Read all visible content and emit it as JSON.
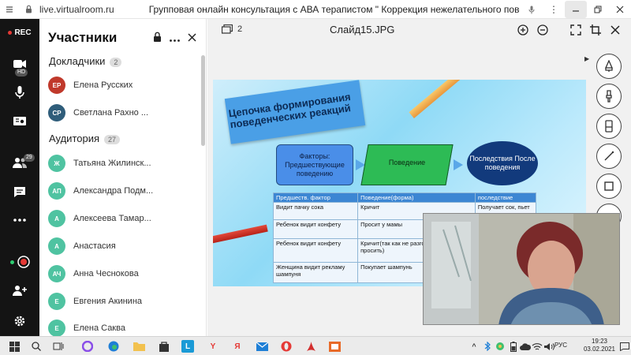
{
  "browser": {
    "url": "live.virtualroom.ru",
    "tab_title": "Групповая онлайн консультация с АВА терапистом \" Коррекция нежелательного поведения\"."
  },
  "rail": {
    "rec_label": "REC",
    "camera_badge": "HD",
    "participants_badge": "29"
  },
  "participants": {
    "title": "Участники",
    "speakers_label": "Докладчики",
    "speakers_count": "2",
    "audience_label": "Аудитория",
    "audience_count": "27",
    "speakers": [
      {
        "initials": "ЕР",
        "name": "Елена Русских",
        "color": "#c0392b"
      },
      {
        "initials": "СР",
        "name": "Светлана Рахно ...",
        "color": "#2f5d7a"
      }
    ],
    "audience": [
      {
        "initials": "Ж",
        "name": "Татьяна Жилинск...",
        "color": "#4fc3a1"
      },
      {
        "initials": "АП",
        "name": "Александра Подм...",
        "color": "#4fc3a1"
      },
      {
        "initials": "А",
        "name": "Алексеева Тамар...",
        "color": "#4fc3a1"
      },
      {
        "initials": "А",
        "name": "Анастасия",
        "color": "#4fc3a1"
      },
      {
        "initials": "АЧ",
        "name": "Анна Чеснокова",
        "color": "#4fc3a1"
      },
      {
        "initials": "Е",
        "name": "Евгения Акинина",
        "color": "#4fc3a1"
      },
      {
        "initials": "Е",
        "name": "Елена Саква",
        "color": "#4fc3a1"
      }
    ]
  },
  "viewer": {
    "page_count": "2",
    "file_name": "Слайд15.JPG"
  },
  "slide": {
    "title": "Цепочка формирования поведенческих реакций",
    "box_factors": "Факторы: Предшествующие поведению",
    "box_behavior": "Поведение",
    "box_consequences": "Последствия После поведения",
    "table_headers": [
      "Предшеств. фактор",
      "Поведение(форма)",
      "последствие"
    ],
    "table_rows": [
      [
        "Видит пачку сока",
        "Кричит",
        "Получает сок, пьет сок"
      ],
      [
        "Ребенок видит конфету",
        "Просит у мамы",
        ""
      ],
      [
        "Ребенок видит конфету",
        "Кричит(так как не разговаривает и не у просить)",
        ""
      ],
      [
        "Женщина видит рекламу шампуня",
        "Покупает шампунь",
        ""
      ]
    ]
  },
  "taskbar": {
    "language": "РУС",
    "time": "19:23",
    "date": "03.02.2021"
  }
}
